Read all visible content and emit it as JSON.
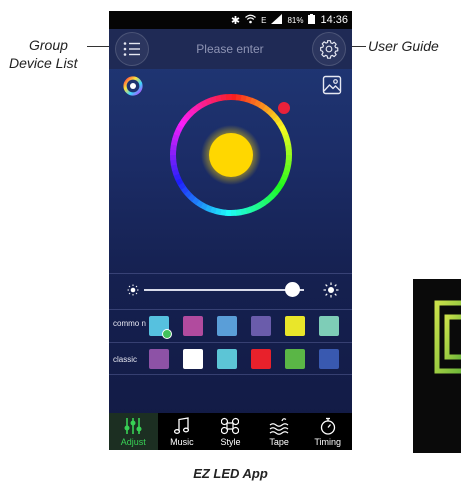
{
  "callouts": {
    "group_line1": "Group",
    "group_line2": "Device List",
    "user_guide": "User Guide"
  },
  "status_bar": {
    "network_letter": "E",
    "battery": "81%",
    "time": "14:36"
  },
  "top_bar": {
    "search_placeholder": "Please enter",
    "left_icon": "list-icon",
    "right_icon": "gear-icon"
  },
  "color_picker": {
    "selected_color": "#ffd700",
    "marker_color": "#e8213a"
  },
  "brightness": {
    "level_fraction": 0.93
  },
  "swatches": {
    "common_label": "commo n",
    "common": [
      "#56c1df",
      "#b14b9e",
      "#5a9ed8",
      "#6a5cab",
      "#e9e62a",
      "#7ecdb7"
    ],
    "common_selected_index": 0,
    "classic_label": "classic",
    "classic": [
      "#8d52a6",
      "#ffffff",
      "#5cc5d6",
      "#e8212b",
      "#5ab646",
      "#3959b0"
    ]
  },
  "tabs": [
    {
      "label": "Adjust",
      "icon": "sliders-icon",
      "active": true
    },
    {
      "label": "Music",
      "icon": "music-note-icon",
      "active": false
    },
    {
      "label": "Style",
      "icon": "command-icon",
      "active": false
    },
    {
      "label": "Tape",
      "icon": "waves-icon",
      "active": false
    },
    {
      "label": "Timing",
      "icon": "timer-icon",
      "active": false
    }
  ],
  "colors": {
    "active_tab": "#38d155",
    "logo_green": "#a6d23a"
  },
  "caption": "EZ LED App"
}
